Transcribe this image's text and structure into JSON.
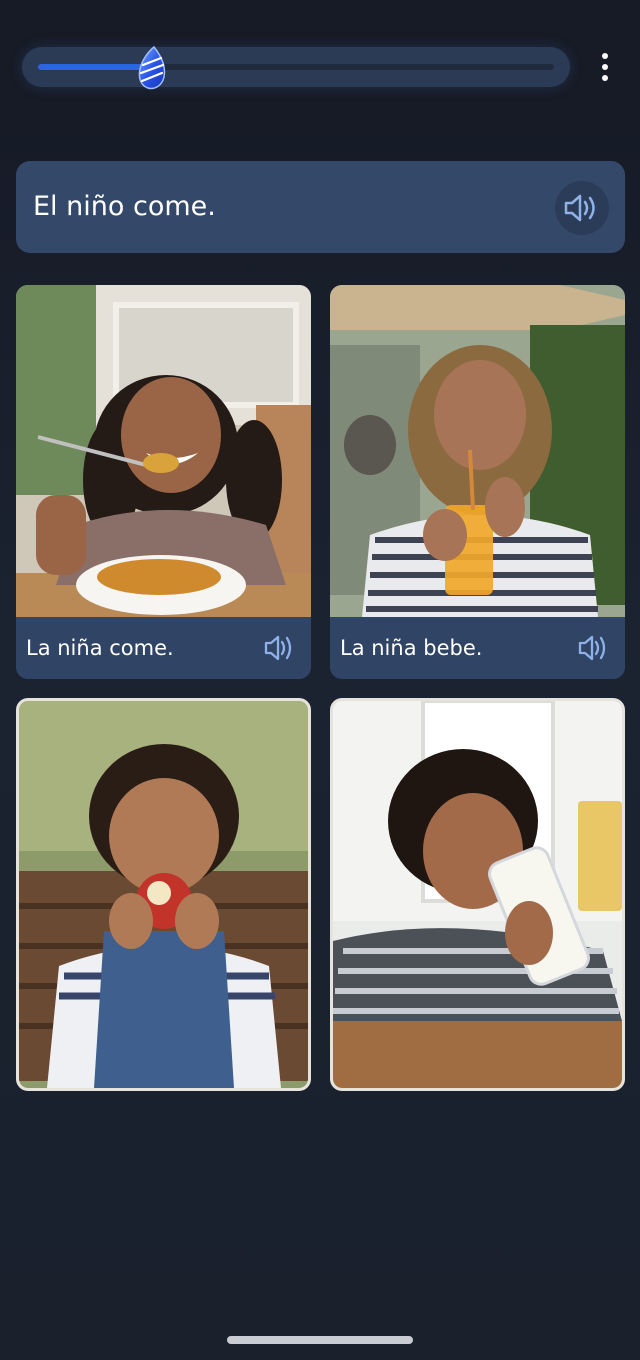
{
  "progress": {
    "value": 0.21,
    "color": "#2f63e6"
  },
  "menu": {
    "icon": "more-vertical-icon"
  },
  "prompt": {
    "text": "El niño come.",
    "audio_icon": "speaker-icon"
  },
  "options": [
    {
      "caption": "La niña come.",
      "image": "girl-eating-curry",
      "audio_icon": "speaker-icon"
    },
    {
      "caption": "La niña bebe.",
      "image": "girl-drinking-juice",
      "audio_icon": "speaker-icon"
    },
    {
      "caption": "",
      "image": "toddler-eating-apple"
    },
    {
      "caption": "",
      "image": "boy-drinking-milk"
    }
  ],
  "colors": {
    "background": "#1b2230",
    "card": "#304465",
    "accent": "#2f63e6",
    "icon": "#8fb1e8"
  }
}
